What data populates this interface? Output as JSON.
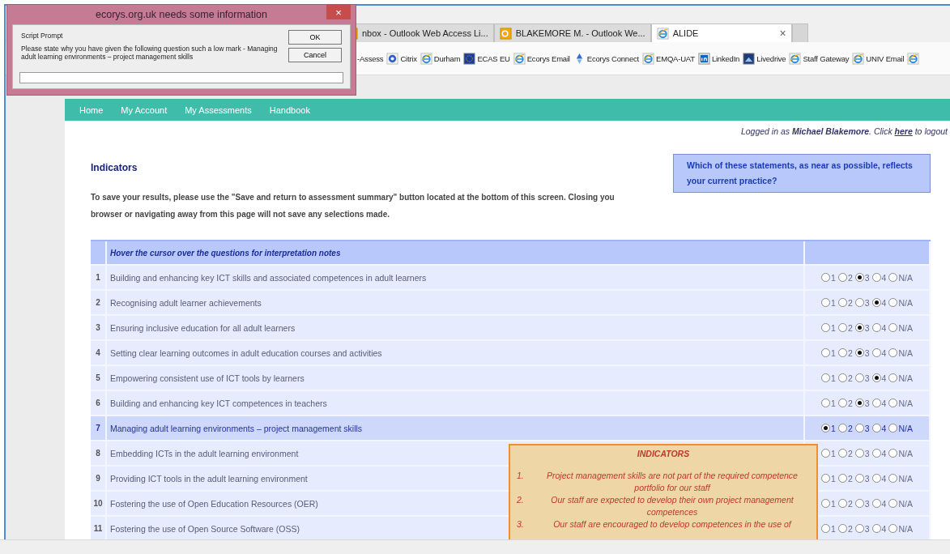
{
  "browser": {
    "tabs": [
      {
        "label": "nbox - Outlook Web Access Li...",
        "selected": false,
        "kind": "outlook"
      },
      {
        "label": "BLAKEMORE M. - Outlook We...",
        "selected": false,
        "kind": "outlook"
      },
      {
        "label": "ALIDE",
        "selected": true,
        "kind": "ie",
        "close": "×"
      }
    ],
    "favorites": [
      {
        "label": "-Assess",
        "kind": "none"
      },
      {
        "label": "Citrix",
        "kind": "citrix"
      },
      {
        "label": "Durham",
        "kind": "ie"
      },
      {
        "label": "ECAS EU",
        "kind": "eu"
      },
      {
        "label": "Ecorys Email",
        "kind": "ie"
      },
      {
        "label": "Ecorys Connect",
        "kind": "arrow"
      },
      {
        "label": "EMQA-UAT",
        "kind": "ie"
      },
      {
        "label": "LinkedIn",
        "kind": "linkedin"
      },
      {
        "label": "Livedrive",
        "kind": "livedrive"
      },
      {
        "label": "Staff Gateway",
        "kind": "ie"
      },
      {
        "label": "UNIV Email",
        "kind": "ie"
      }
    ]
  },
  "nav": [
    {
      "label": "Home"
    },
    {
      "label": "My Account"
    },
    {
      "label": "My Assessments"
    },
    {
      "label": "Handbook"
    }
  ],
  "login": {
    "prefix": "Logged in as **Michael Blakemore**. Click",
    "link": "here",
    "suffix": "to logout"
  },
  "title": "Indicators",
  "question_box": "Which of these statements, as near as possible, reflects your current practice?",
  "instructions": "To save your results, please use the \"Save and return to assessment summary\" button located at the bottom of this screen. Closing you browser or navigating away from this page will not save any selections made.",
  "table": {
    "header": "Hover the cursor over the questions for interpretation notes",
    "rows": [
      {
        "number": "1",
        "text": "Building and enhancing key ICT skills and associated competences in adult learners",
        "highlighted": false,
        "choices": [
          {
            "label": "1",
            "selected": false
          },
          {
            "label": "2",
            "selected": false
          },
          {
            "label": "3",
            "selected": true
          },
          {
            "label": "4",
            "selected": false
          },
          {
            "label": "N/A",
            "selected": false
          }
        ]
      },
      {
        "number": "2",
        "text": "Recognising adult learner achievements",
        "highlighted": false,
        "choices": [
          {
            "label": "1",
            "selected": false
          },
          {
            "label": "2",
            "selected": false
          },
          {
            "label": "3",
            "selected": false
          },
          {
            "label": "4",
            "selected": true
          },
          {
            "label": "N/A",
            "selected": false
          }
        ]
      },
      {
        "number": "3",
        "text": "Ensuring inclusive education for all adult learners",
        "highlighted": false,
        "choices": [
          {
            "label": "1",
            "selected": false
          },
          {
            "label": "2",
            "selected": false
          },
          {
            "label": "3",
            "selected": true
          },
          {
            "label": "4",
            "selected": false
          },
          {
            "label": "N/A",
            "selected": false
          }
        ]
      },
      {
        "number": "4",
        "text": "Setting clear learning outcomes in adult education courses and activities",
        "highlighted": false,
        "choices": [
          {
            "label": "1",
            "selected": false
          },
          {
            "label": "2",
            "selected": false
          },
          {
            "label": "3",
            "selected": true
          },
          {
            "label": "4",
            "selected": false
          },
          {
            "label": "N/A",
            "selected": false
          }
        ]
      },
      {
        "number": "5",
        "text": "Empowering consistent use of ICT tools by learners",
        "highlighted": false,
        "choices": [
          {
            "label": "1",
            "selected": false
          },
          {
            "label": "2",
            "selected": false
          },
          {
            "label": "3",
            "selected": false
          },
          {
            "label": "4",
            "selected": true
          },
          {
            "label": "N/A",
            "selected": false
          }
        ]
      },
      {
        "number": "6",
        "text": "Building and enhancing key ICT competences in teachers",
        "highlighted": false,
        "choices": [
          {
            "label": "1",
            "selected": false
          },
          {
            "label": "2",
            "selected": false
          },
          {
            "label": "3",
            "selected": true
          },
          {
            "label": "4",
            "selected": false
          },
          {
            "label": "N/A",
            "selected": false
          }
        ]
      },
      {
        "number": "7",
        "text": "Managing adult learning environments – project management skills",
        "highlighted": true,
        "choices": [
          {
            "label": "1",
            "selected": true
          },
          {
            "label": "2",
            "selected": false
          },
          {
            "label": "3",
            "selected": false
          },
          {
            "label": "4",
            "selected": false
          },
          {
            "label": "N/A",
            "selected": false
          }
        ]
      },
      {
        "number": "8",
        "text": "Embedding ICTs in the adult learning environment",
        "highlighted": false,
        "choices": [
          {
            "label": "1",
            "selected": false
          },
          {
            "label": "2",
            "selected": false
          },
          {
            "label": "3",
            "selected": false
          },
          {
            "label": "4",
            "selected": false
          },
          {
            "label": "N/A",
            "selected": false
          }
        ]
      },
      {
        "number": "9",
        "text": "Providing ICT tools in the adult learning environment",
        "highlighted": false,
        "choices": [
          {
            "label": "1",
            "selected": false
          },
          {
            "label": "2",
            "selected": false
          },
          {
            "label": "3",
            "selected": false
          },
          {
            "label": "4",
            "selected": false
          },
          {
            "label": "N/A",
            "selected": false
          }
        ]
      },
      {
        "number": "10",
        "text": "Fostering the use of Open Education Resources (OER)",
        "highlighted": false,
        "choices": [
          {
            "label": "1",
            "selected": false
          },
          {
            "label": "2",
            "selected": false
          },
          {
            "label": "3",
            "selected": false
          },
          {
            "label": "4",
            "selected": false
          },
          {
            "label": "N/A",
            "selected": false
          }
        ]
      },
      {
        "number": "11",
        "text": "Fostering the use of Open Source Software (OSS)",
        "highlighted": false,
        "choices": [
          {
            "label": "1",
            "selected": false
          },
          {
            "label": "2",
            "selected": false
          },
          {
            "label": "3",
            "selected": false
          },
          {
            "label": "4",
            "selected": false
          },
          {
            "label": "N/A",
            "selected": false
          }
        ]
      }
    ]
  },
  "tooltip": {
    "title": "INDICATORS",
    "items": [
      {
        "number": "1.",
        "text": "Project management skills are not part of the required competence portfolio for our staff"
      },
      {
        "number": "2.",
        "text": "Our staff are expected to develop their own project management competences"
      },
      {
        "number": "3.",
        "text": "Our staff are encouraged to develop competences in the use of"
      }
    ]
  },
  "dialog": {
    "title": "ecorys.org.uk needs some information",
    "close": "×",
    "label": "Script Prompt",
    "message": "Please state why you have given the following question such a low mark - Managing adult learning environments – project management skills",
    "buttons": [
      "OK",
      "Cancel"
    ]
  }
}
